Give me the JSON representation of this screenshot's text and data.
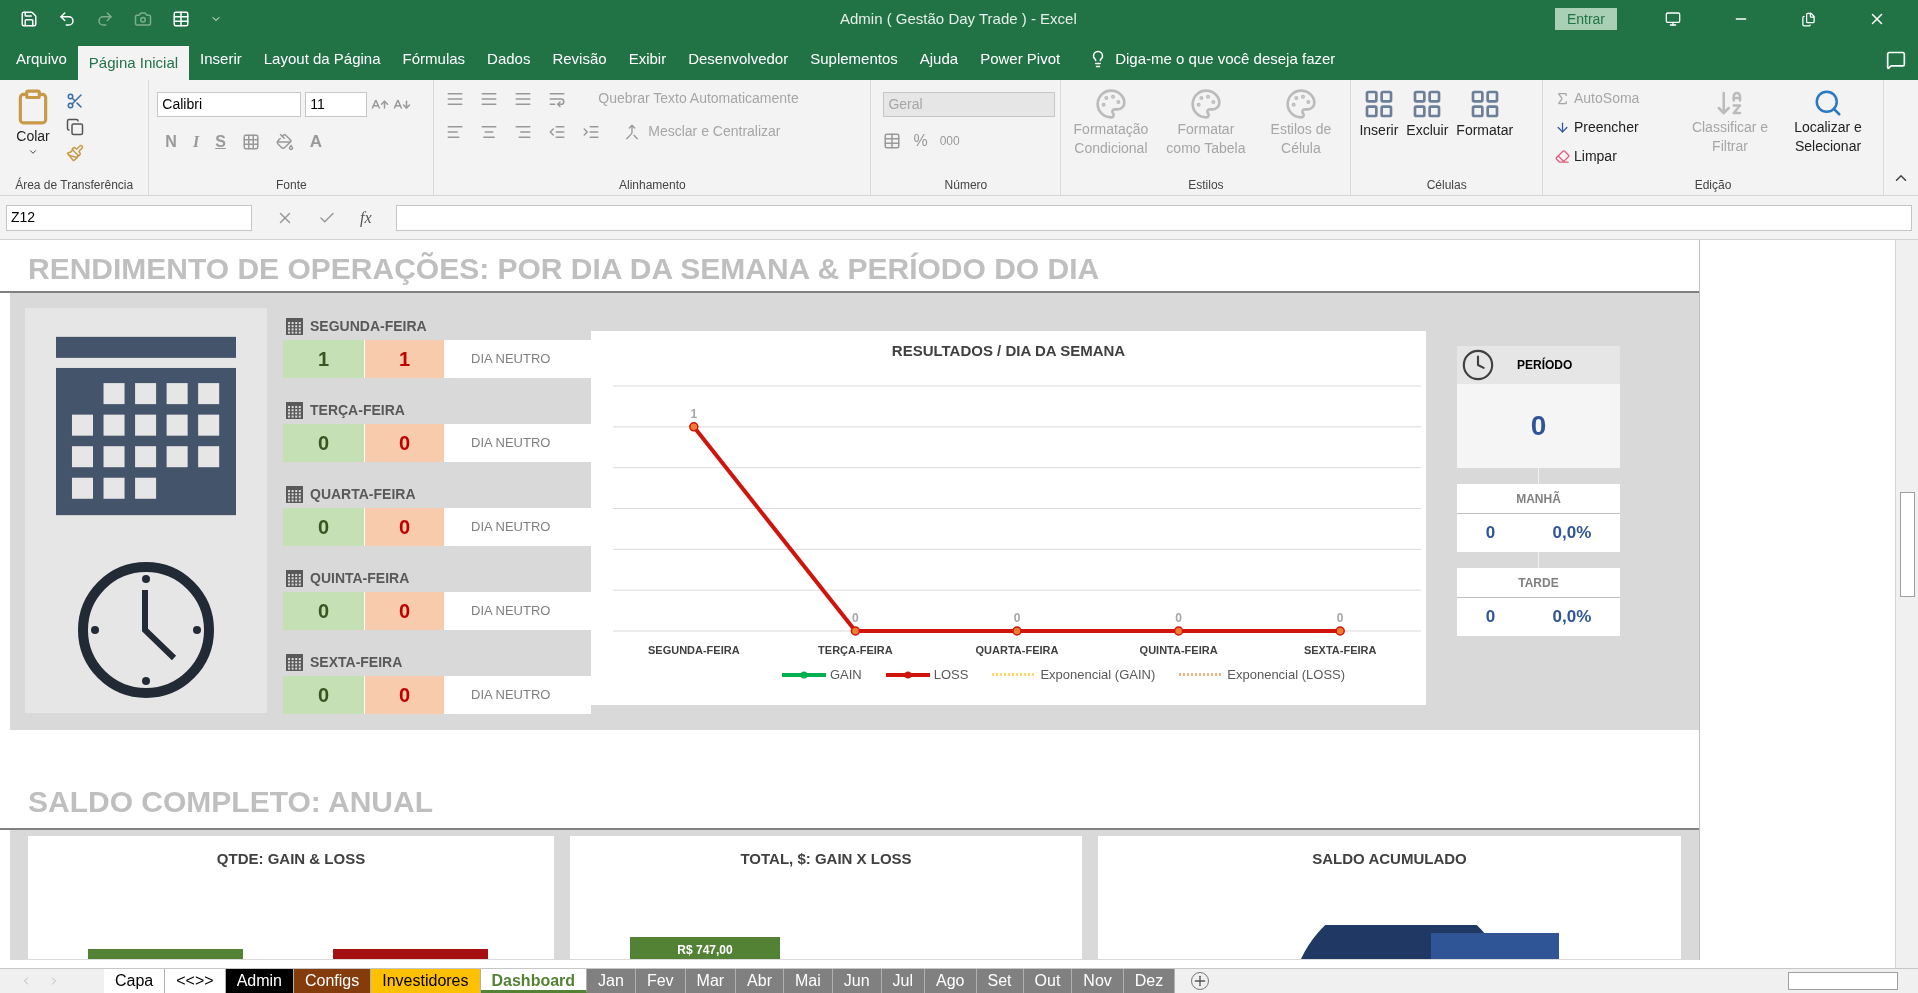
{
  "title_bar": {
    "title": "Admin ( Gestão Day Trade ) - Excel",
    "sign_in": "Entrar"
  },
  "menu_tabs": [
    {
      "label": "Arquivo",
      "selected": false
    },
    {
      "label": "Página Inicial",
      "selected": true
    },
    {
      "label": "Inserir",
      "selected": false
    },
    {
      "label": "Layout da Página",
      "selected": false
    },
    {
      "label": "Fórmulas",
      "selected": false
    },
    {
      "label": "Dados",
      "selected": false
    },
    {
      "label": "Revisão",
      "selected": false
    },
    {
      "label": "Exibir",
      "selected": false
    },
    {
      "label": "Desenvolvedor",
      "selected": false
    },
    {
      "label": "Suplementos",
      "selected": false
    },
    {
      "label": "Ajuda",
      "selected": false
    },
    {
      "label": "Power Pivot",
      "selected": false
    }
  ],
  "tell_me": "Diga-me o que você deseja fazer",
  "ribbon": {
    "clipboard": {
      "paste": "Colar",
      "label": "Área de Transferência"
    },
    "font": {
      "name": "Calibri",
      "size": "11",
      "style_buttons": [
        "N",
        "I",
        "S"
      ],
      "color_button": "A",
      "label": "Fonte"
    },
    "alignment": {
      "wrap": "Quebrar Texto Automaticamente",
      "merge": "Mesclar e Centralizar",
      "label": "Alinhamento"
    },
    "number": {
      "format": "Geral",
      "percent": "%",
      "thousands": "000",
      "label": "Número"
    },
    "styles": {
      "buttons": [
        {
          "label": "Formatação Condicional",
          "disabled": true
        },
        {
          "label": "Formatar como Tabela",
          "disabled": true
        },
        {
          "label": "Estilos de Célula",
          "disabled": true
        }
      ],
      "label": "Estilos"
    },
    "cells": {
      "buttons": [
        {
          "label": "Inserir",
          "disabled": false
        },
        {
          "label": "Excluir",
          "disabled": false
        },
        {
          "label": "Formatar",
          "disabled": false
        }
      ],
      "label": "Células"
    },
    "editing": {
      "small": [
        {
          "label": "AutoSoma",
          "disabled": true
        },
        {
          "label": "Preencher",
          "disabled": false
        },
        {
          "label": "Limpar",
          "disabled": false
        }
      ],
      "large": [
        {
          "label": "Classificar e Filtrar",
          "disabled": true
        },
        {
          "label": "Localizar e Selecionar",
          "disabled": false
        }
      ],
      "label": "Edição"
    }
  },
  "formula_bar": {
    "name_box": "Z12",
    "fx": "fx"
  },
  "section_1": {
    "title": "RENDIMENTO DE OPERAÇÕES: POR DIA DA SEMANA & PERÍODO DO DIA",
    "days": [
      {
        "name": "SEGUNDA-FEIRA",
        "gain": "1",
        "loss": "1",
        "status": "DIA NEUTRO"
      },
      {
        "name": "TERÇA-FEIRA",
        "gain": "0",
        "loss": "0",
        "status": "DIA NEUTRO"
      },
      {
        "name": "QUARTA-FEIRA",
        "gain": "0",
        "loss": "0",
        "status": "DIA NEUTRO"
      },
      {
        "name": "QUINTA-FEIRA",
        "gain": "0",
        "loss": "0",
        "status": "DIA NEUTRO"
      },
      {
        "name": "SEXTA-FEIRA",
        "gain": "0",
        "loss": "0",
        "status": "DIA NEUTRO"
      }
    ],
    "chart": {
      "chart_data": {
        "type": "line",
        "title": "RESULTADOS / DIA DA SEMANA",
        "categories": [
          "SEGUNDA-FEIRA",
          "TERÇA-FEIRA",
          "QUARTA-FEIRA",
          "QUINTA-FEIRA",
          "SEXTA-FEIRA"
        ],
        "series": [
          {
            "name": "GAIN",
            "color": "#00b050",
            "marker": "circle",
            "values": [
              null,
              null,
              null,
              null,
              null
            ]
          },
          {
            "name": "LOSS",
            "color": "#d0140c",
            "marker": "circle",
            "values": [
              1,
              0,
              0,
              0,
              0
            ]
          }
        ],
        "data_labels": true,
        "legend": "bottom"
      },
      "trend_legend": [
        {
          "label": "Exponencial (GAIN)",
          "color": "#ffd966"
        },
        {
          "label": "Exponencial (LOSS)",
          "color": "#f4b183"
        }
      ]
    },
    "period": {
      "title": "PERÍODO",
      "value": "0",
      "parts": [
        {
          "label": "MANHÃ",
          "count": "0",
          "share": "0,0%"
        },
        {
          "label": "TARDE",
          "count": "0",
          "share": "0,0%"
        }
      ]
    }
  },
  "section_2": {
    "title": "SALDO COMPLETO: ANUAL",
    "cards": [
      {
        "title": "QTDE: GAIN & LOSS",
        "kind": "bars"
      },
      {
        "title": "TOTAL, $: GAIN X LOSS",
        "kind": "single_bar",
        "bar_label": "R$ 747,00"
      },
      {
        "title": "SALDO ACUMULADO",
        "kind": "donut"
      }
    ]
  },
  "sheet_tabs": [
    {
      "label": "Capa",
      "selected": false
    },
    {
      "label": "<<>>",
      "selected": false
    },
    {
      "label": "Admin",
      "selected": false,
      "color": "#000000"
    },
    {
      "label": "Configs",
      "selected": false,
      "color": "#843c0c"
    },
    {
      "label": "Investidores",
      "selected": false,
      "color": "#ffc000"
    },
    {
      "label": "Dashboard",
      "selected": true,
      "color": "#548235"
    },
    {
      "label": "Jan",
      "selected": false,
      "color": "#808080"
    },
    {
      "label": "Fev",
      "selected": false,
      "color": "#808080"
    },
    {
      "label": "Mar",
      "selected": false,
      "color": "#808080"
    },
    {
      "label": "Abr",
      "selected": false,
      "color": "#808080"
    },
    {
      "label": "Mai",
      "selected": false,
      "color": "#808080"
    },
    {
      "label": "Jun",
      "selected": false,
      "color": "#808080"
    },
    {
      "label": "Jul",
      "selected": false,
      "color": "#808080"
    },
    {
      "label": "Ago",
      "selected": false,
      "color": "#808080"
    },
    {
      "label": "Set",
      "selected": false,
      "color": "#808080"
    },
    {
      "label": "Out",
      "selected": false,
      "color": "#808080"
    },
    {
      "label": "Nov",
      "selected": false,
      "color": "#808080"
    },
    {
      "label": "Dez",
      "selected": false,
      "color": "#808080"
    }
  ]
}
